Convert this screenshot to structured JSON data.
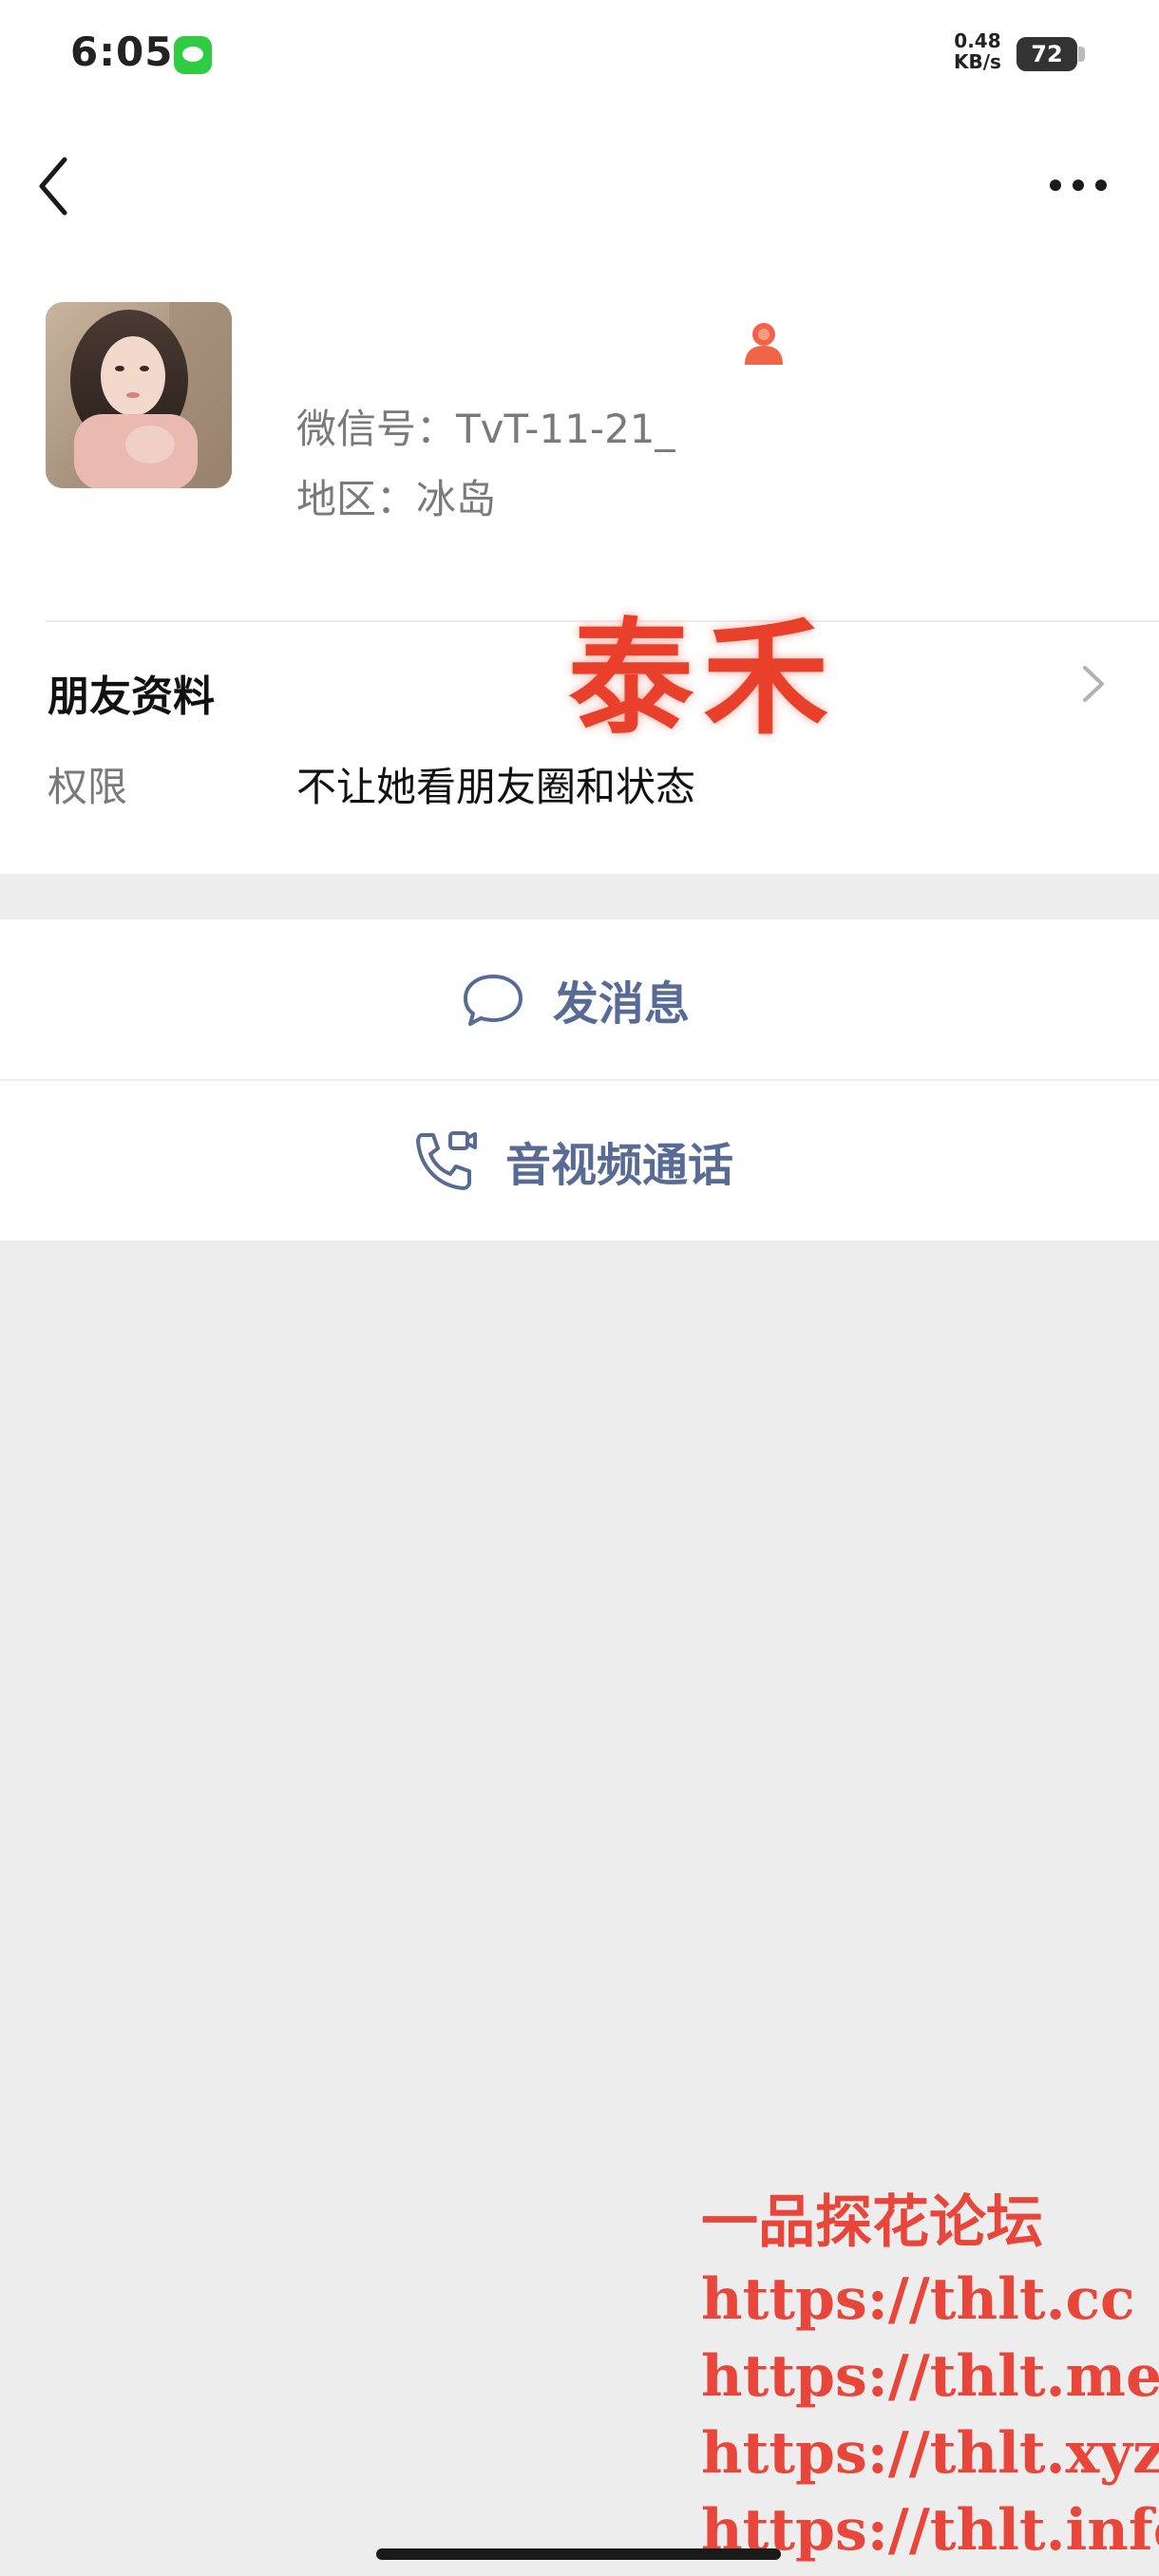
{
  "status_bar": {
    "time": "6:05",
    "net_speed_value": "0.48",
    "net_speed_unit": "KB/s",
    "battery": "72",
    "message_app_icon": "message-icon",
    "message_app_color": "#2ecc40"
  },
  "nav": {
    "back_icon": "chevron-left-icon",
    "more_icon": "more-icon"
  },
  "profile": {
    "avatar_icon": "avatar-photo",
    "gender_icon": "female-icon",
    "gender_color": "#f06448",
    "wechat_id": "微信号：TvT-11-21_",
    "region": "地区：冰岛",
    "watermark_name": "泰禾"
  },
  "friend_info": {
    "label": "朋友资料",
    "chevron_icon": "chevron-right-icon"
  },
  "permissions": {
    "label": "权限",
    "value": "不让她看朋友圈和状态"
  },
  "actions": {
    "send_message": "发消息",
    "send_message_icon": "chat-bubble-icon",
    "video_call": "音视频通话",
    "video_call_icon": "phone-video-icon",
    "link_color": "#576b95"
  },
  "watermark_links": {
    "forum_name": "一品探花论坛",
    "links": [
      "https://thlt.cc",
      "https://thlt.me",
      "https://thlt.xyz",
      "https://thlt.info"
    ],
    "color": "#e8463a"
  }
}
